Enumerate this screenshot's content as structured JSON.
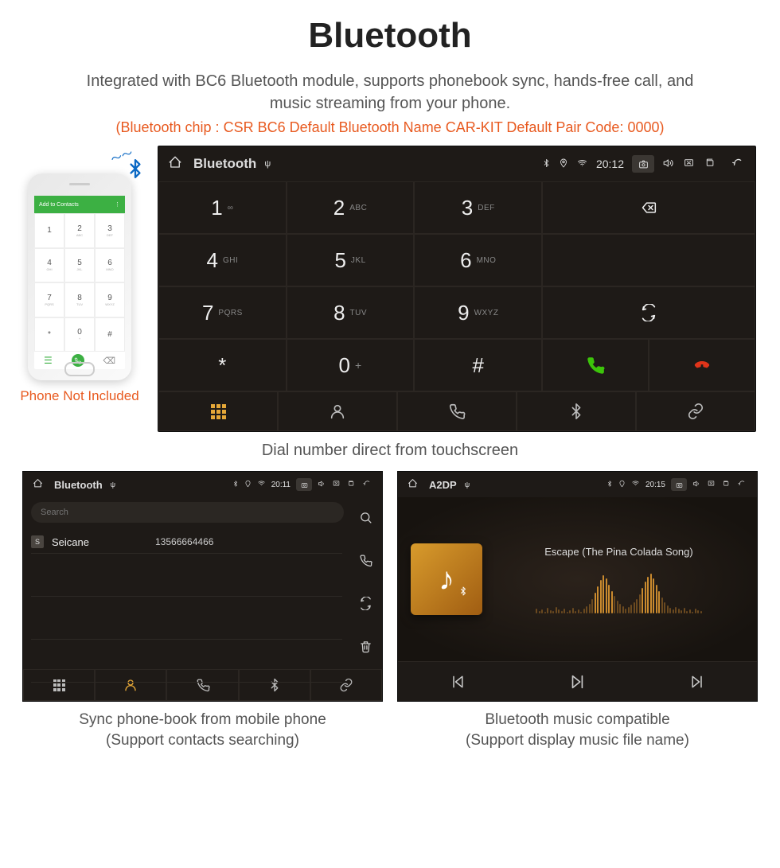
{
  "header": {
    "title": "Bluetooth",
    "subtitle": "Integrated with BC6 Bluetooth module, supports phonebook sync, hands-free call, and music streaming from your phone.",
    "specs": "(Bluetooth chip : CSR BC6    Default Bluetooth Name CAR-KIT    Default Pair Code: 0000)"
  },
  "phone": {
    "add_contacts": "Add to Contacts",
    "note": "Phone Not Included"
  },
  "dialer": {
    "status": {
      "title": "Bluetooth",
      "time": "20:12"
    },
    "keys": {
      "k1n": "1",
      "k1l": "∞",
      "k2n": "2",
      "k2l": "ABC",
      "k3n": "3",
      "k3l": "DEF",
      "k4n": "4",
      "k4l": "GHI",
      "k5n": "5",
      "k5l": "JKL",
      "k6n": "6",
      "k6l": "MNO",
      "k7n": "7",
      "k7l": "PQRS",
      "k8n": "8",
      "k8l": "TUV",
      "k9n": "9",
      "k9l": "WXYZ",
      "star": "*",
      "k0n": "0",
      "k0l": "+",
      "hash": "#"
    },
    "caption": "Dial number direct from touchscreen"
  },
  "phonebook": {
    "status": {
      "title": "Bluetooth",
      "time": "20:11"
    },
    "search_placeholder": "Search",
    "contact_badge": "S",
    "contact_name": "Seicane",
    "contact_number": "13566664466",
    "caption1": "Sync phone-book from mobile phone",
    "caption2": "(Support contacts searching)"
  },
  "music": {
    "status": {
      "title": "A2DP",
      "time": "20:15"
    },
    "track": "Escape (The Pina Colada Song)",
    "caption1": "Bluetooth music compatible",
    "caption2": "(Support display music file name)"
  }
}
